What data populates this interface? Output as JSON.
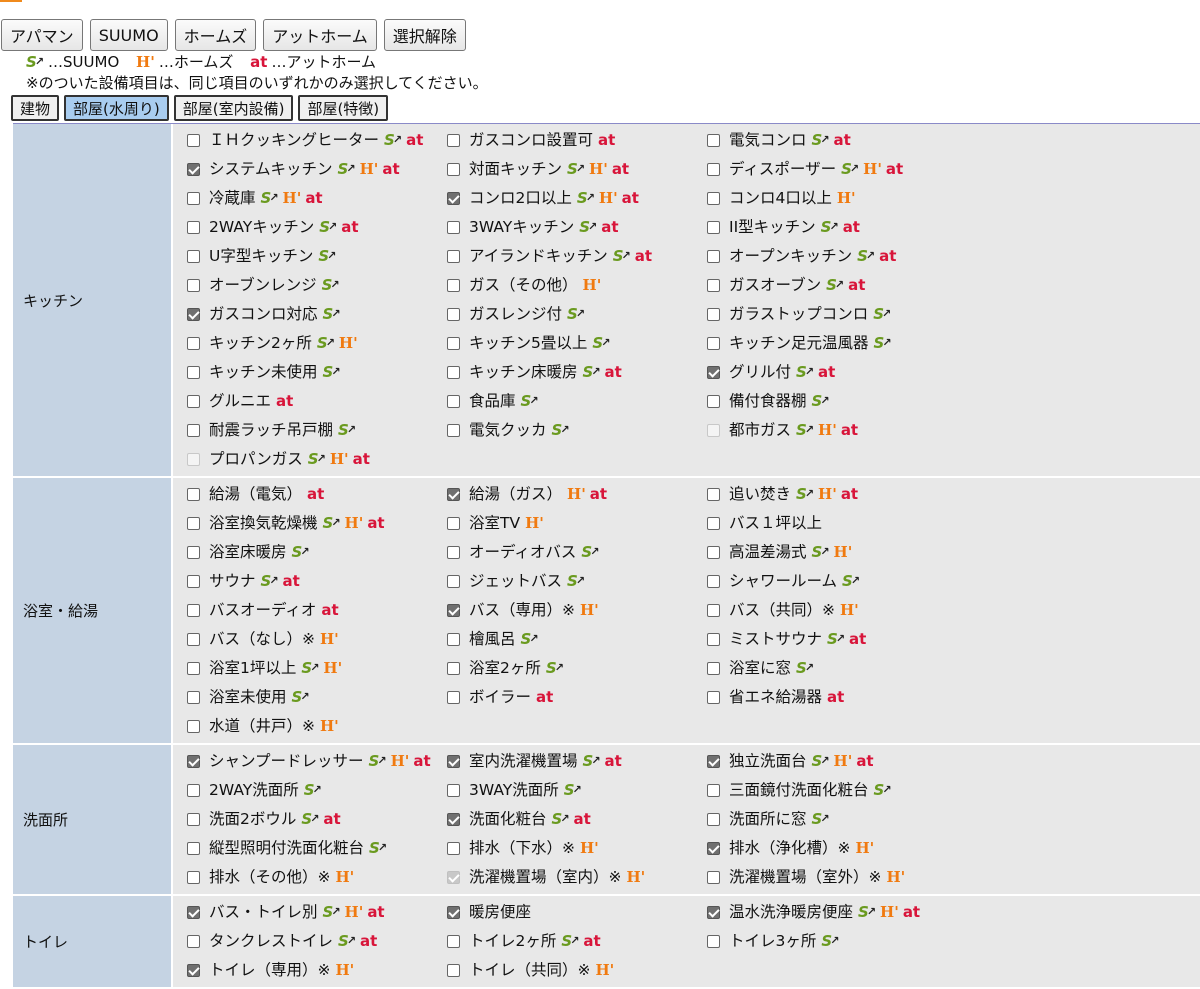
{
  "colors": {
    "suumo": "#6a9a1f",
    "homes": "#f07a10",
    "athome": "#d8153a",
    "active_tab": "#a9cdf0",
    "category_bg": "#c5d3e3",
    "items_bg": "#e8e8e8"
  },
  "top_buttons": [
    "アパマン",
    "SUUMO",
    "ホームズ",
    "アットホーム",
    "選択解除"
  ],
  "legend": {
    "suumo_icon": "S",
    "suumo_text": "…SUUMO",
    "homes_icon": "H'",
    "homes_text": "…ホームズ",
    "athome_icon": "at",
    "athome_text": "…アットホーム"
  },
  "note": "※のついた設備項目は、同じ項目のいずれかのみ選択してください。",
  "tabs": [
    {
      "label": "建物",
      "active": false
    },
    {
      "label": "部屋(水周り)",
      "active": true
    },
    {
      "label": "部屋(室内設備)",
      "active": false
    },
    {
      "label": "部屋(特徴)",
      "active": false
    }
  ],
  "sections": [
    {
      "category": "キッチン",
      "items": [
        {
          "label": "ＩＨクッキングヒーター",
          "checked": false,
          "s": true,
          "h": false,
          "a": true
        },
        {
          "label": "ガスコンロ設置可",
          "checked": false,
          "s": false,
          "h": false,
          "a": true
        },
        {
          "label": "電気コンロ",
          "checked": false,
          "s": true,
          "h": false,
          "a": true
        },
        {
          "label": "システムキッチン",
          "checked": true,
          "s": true,
          "h": true,
          "a": true
        },
        {
          "label": "対面キッチン",
          "checked": false,
          "s": true,
          "h": true,
          "a": true
        },
        {
          "label": "ディスポーザー",
          "checked": false,
          "s": true,
          "h": true,
          "a": true
        },
        {
          "label": "冷蔵庫",
          "checked": false,
          "s": true,
          "h": true,
          "a": true
        },
        {
          "label": "コンロ2口以上",
          "checked": true,
          "s": true,
          "h": true,
          "a": true
        },
        {
          "label": "コンロ4口以上",
          "checked": false,
          "s": false,
          "h": true,
          "a": false
        },
        {
          "label": "2WAYキッチン",
          "checked": false,
          "s": true,
          "h": false,
          "a": true
        },
        {
          "label": "3WAYキッチン",
          "checked": false,
          "s": true,
          "h": false,
          "a": true
        },
        {
          "label": "II型キッチン",
          "checked": false,
          "s": true,
          "h": false,
          "a": true
        },
        {
          "label": "U字型キッチン",
          "checked": false,
          "s": true,
          "h": false,
          "a": false
        },
        {
          "label": "アイランドキッチン",
          "checked": false,
          "s": true,
          "h": false,
          "a": true
        },
        {
          "label": "オープンキッチン",
          "checked": false,
          "s": true,
          "h": false,
          "a": true
        },
        {
          "label": "オーブンレンジ",
          "checked": false,
          "s": true,
          "h": false,
          "a": false
        },
        {
          "label": "ガス（その他）",
          "checked": false,
          "s": false,
          "h": true,
          "a": false
        },
        {
          "label": "ガスオーブン",
          "checked": false,
          "s": true,
          "h": false,
          "a": true
        },
        {
          "label": "ガスコンロ対応",
          "checked": true,
          "s": true,
          "h": false,
          "a": false
        },
        {
          "label": "ガスレンジ付",
          "checked": false,
          "s": true,
          "h": false,
          "a": false
        },
        {
          "label": "ガラストップコンロ",
          "checked": false,
          "s": true,
          "h": false,
          "a": false
        },
        {
          "label": "キッチン2ヶ所",
          "checked": false,
          "s": true,
          "h": true,
          "a": false
        },
        {
          "label": "キッチン5畳以上",
          "checked": false,
          "s": true,
          "h": false,
          "a": false
        },
        {
          "label": "キッチン足元温風器",
          "checked": false,
          "s": true,
          "h": false,
          "a": false
        },
        {
          "label": "キッチン未使用",
          "checked": false,
          "s": true,
          "h": false,
          "a": false
        },
        {
          "label": "キッチン床暖房",
          "checked": false,
          "s": true,
          "h": false,
          "a": true
        },
        {
          "label": "グリル付",
          "checked": true,
          "s": true,
          "h": false,
          "a": true
        },
        {
          "label": "グルニエ",
          "checked": false,
          "s": false,
          "h": false,
          "a": true
        },
        {
          "label": "食品庫",
          "checked": false,
          "s": true,
          "h": false,
          "a": false
        },
        {
          "label": "備付食器棚",
          "checked": false,
          "s": true,
          "h": false,
          "a": false
        },
        {
          "label": "耐震ラッチ吊戸棚",
          "checked": false,
          "s": true,
          "h": false,
          "a": false
        },
        {
          "label": "電気クッカ",
          "checked": false,
          "s": true,
          "h": false,
          "a": false
        },
        {
          "label": "都市ガス",
          "checked": false,
          "disabled": true,
          "s": true,
          "h": true,
          "a": true
        },
        {
          "label": "プロパンガス",
          "checked": false,
          "disabled": true,
          "s": true,
          "h": true,
          "a": true
        }
      ]
    },
    {
      "category": "浴室・給湯",
      "items": [
        {
          "label": "給湯（電気）",
          "checked": false,
          "s": false,
          "h": false,
          "a": true
        },
        {
          "label": "給湯（ガス）",
          "checked": true,
          "s": false,
          "h": true,
          "a": true
        },
        {
          "label": "追い焚き",
          "checked": false,
          "s": true,
          "h": true,
          "a": true
        },
        {
          "label": "浴室換気乾燥機",
          "checked": false,
          "s": true,
          "h": true,
          "a": true
        },
        {
          "label": "浴室TV",
          "checked": false,
          "s": false,
          "h": true,
          "a": false
        },
        {
          "label": "バス１坪以上",
          "checked": false,
          "s": false,
          "h": false,
          "a": false
        },
        {
          "label": "浴室床暖房",
          "checked": false,
          "s": true,
          "h": false,
          "a": false
        },
        {
          "label": "オーディオバス",
          "checked": false,
          "s": true,
          "h": false,
          "a": false
        },
        {
          "label": "高温差湯式",
          "checked": false,
          "s": true,
          "h": true,
          "a": false
        },
        {
          "label": "サウナ",
          "checked": false,
          "s": true,
          "h": false,
          "a": true
        },
        {
          "label": "ジェットバス",
          "checked": false,
          "s": true,
          "h": false,
          "a": false
        },
        {
          "label": "シャワールーム",
          "checked": false,
          "s": true,
          "h": false,
          "a": false
        },
        {
          "label": "バスオーディオ",
          "checked": false,
          "s": false,
          "h": false,
          "a": true
        },
        {
          "label": "バス（専用）※",
          "checked": true,
          "s": false,
          "h": true,
          "a": false
        },
        {
          "label": "バス（共同）※",
          "checked": false,
          "s": false,
          "h": true,
          "a": false
        },
        {
          "label": "バス（なし）※",
          "checked": false,
          "s": false,
          "h": true,
          "a": false
        },
        {
          "label": "檜風呂",
          "checked": false,
          "s": true,
          "h": false,
          "a": false
        },
        {
          "label": "ミストサウナ",
          "checked": false,
          "s": true,
          "h": false,
          "a": true
        },
        {
          "label": "浴室1坪以上",
          "checked": false,
          "s": true,
          "h": true,
          "a": false
        },
        {
          "label": "浴室2ヶ所",
          "checked": false,
          "s": true,
          "h": false,
          "a": false
        },
        {
          "label": "浴室に窓",
          "checked": false,
          "s": true,
          "h": false,
          "a": false
        },
        {
          "label": "浴室未使用",
          "checked": false,
          "s": true,
          "h": false,
          "a": false
        },
        {
          "label": "ボイラー",
          "checked": false,
          "s": false,
          "h": false,
          "a": true
        },
        {
          "label": "省エネ給湯器",
          "checked": false,
          "s": false,
          "h": false,
          "a": true
        },
        {
          "label": "水道（井戸）※",
          "checked": false,
          "s": false,
          "h": true,
          "a": false
        }
      ]
    },
    {
      "category": "洗面所",
      "items": [
        {
          "label": "シャンプードレッサー",
          "checked": true,
          "s": true,
          "h": true,
          "a": true
        },
        {
          "label": "室内洗濯機置場",
          "checked": true,
          "s": true,
          "h": false,
          "a": true
        },
        {
          "label": "独立洗面台",
          "checked": true,
          "s": true,
          "h": true,
          "a": true
        },
        {
          "label": "2WAY洗面所",
          "checked": false,
          "s": true,
          "h": false,
          "a": false
        },
        {
          "label": "3WAY洗面所",
          "checked": false,
          "s": true,
          "h": false,
          "a": false
        },
        {
          "label": "三面鏡付洗面化粧台",
          "checked": false,
          "s": true,
          "h": false,
          "a": false
        },
        {
          "label": "洗面2ボウル",
          "checked": false,
          "s": true,
          "h": false,
          "a": true
        },
        {
          "label": "洗面化粧台",
          "checked": true,
          "s": true,
          "h": false,
          "a": true
        },
        {
          "label": "洗面所に窓",
          "checked": false,
          "s": true,
          "h": false,
          "a": false
        },
        {
          "label": "縦型照明付洗面化粧台",
          "checked": false,
          "s": true,
          "h": false,
          "a": false
        },
        {
          "label": "排水（下水）※",
          "checked": false,
          "s": false,
          "h": true,
          "a": false
        },
        {
          "label": "排水（浄化槽）※",
          "checked": true,
          "s": false,
          "h": true,
          "a": false
        },
        {
          "label": "排水（その他）※",
          "checked": false,
          "s": false,
          "h": true,
          "a": false
        },
        {
          "label": "洗濯機置場（室内）※",
          "checked": true,
          "disabled": true,
          "s": false,
          "h": true,
          "a": false
        },
        {
          "label": "洗濯機置場（室外）※",
          "checked": false,
          "s": false,
          "h": true,
          "a": false
        }
      ]
    },
    {
      "category": "トイレ",
      "items": [
        {
          "label": "バス・トイレ別",
          "checked": true,
          "s": true,
          "h": true,
          "a": true
        },
        {
          "label": "暖房便座",
          "checked": true,
          "s": false,
          "h": false,
          "a": false
        },
        {
          "label": "温水洗浄暖房便座",
          "checked": true,
          "s": true,
          "h": true,
          "a": true
        },
        {
          "label": "タンクレストイレ",
          "checked": false,
          "s": true,
          "h": false,
          "a": true
        },
        {
          "label": "トイレ2ヶ所",
          "checked": false,
          "s": true,
          "h": false,
          "a": true
        },
        {
          "label": "トイレ3ヶ所",
          "checked": false,
          "s": true,
          "h": false,
          "a": false
        },
        {
          "label": "トイレ（専用）※",
          "checked": true,
          "s": false,
          "h": true,
          "a": false
        },
        {
          "label": "トイレ（共同）※",
          "checked": false,
          "s": false,
          "h": true,
          "a": false
        }
      ]
    }
  ]
}
